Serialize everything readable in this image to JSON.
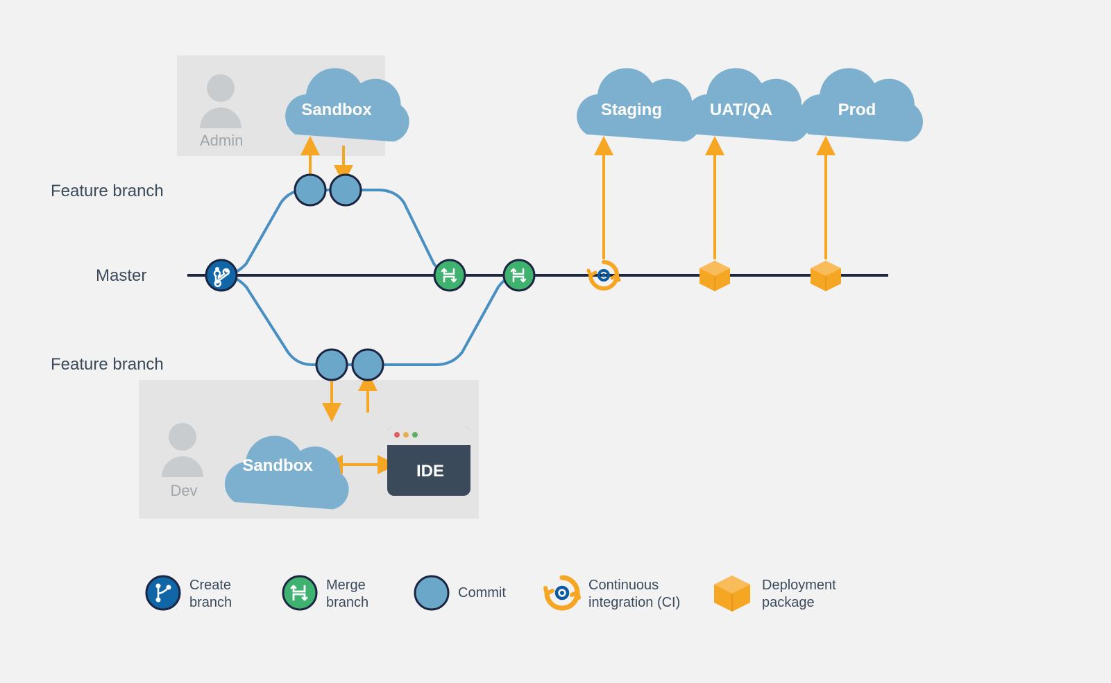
{
  "branches": {
    "feature_top": "Feature branch",
    "master": "Master",
    "feature_bottom": "Feature branch"
  },
  "roles": {
    "admin": "Admin",
    "dev": "Dev"
  },
  "clouds": {
    "admin_sandbox": "Sandbox",
    "dev_sandbox": "Sandbox",
    "staging": "Staging",
    "uat": "UAT/QA",
    "prod": "Prod"
  },
  "ide": "IDE",
  "legend": {
    "create_branch": "Create\nbranch",
    "merge_branch": "Merge\nbranch",
    "commit": "Commit",
    "ci": "Continuous\nintegration (CI)",
    "deploy": "Deployment\npackage"
  },
  "colors": {
    "blue_dark": "#0a5a9e",
    "blue_light": "#6ba7c8",
    "green": "#3fb26f",
    "orange": "#f5a623",
    "navy": "#1f2e4a",
    "line": "#4a8fc2",
    "master_line": "#1b2540",
    "grey_box": "#e4e4e4",
    "cloud": "#7db0ce",
    "text": "#3a4a5a"
  }
}
